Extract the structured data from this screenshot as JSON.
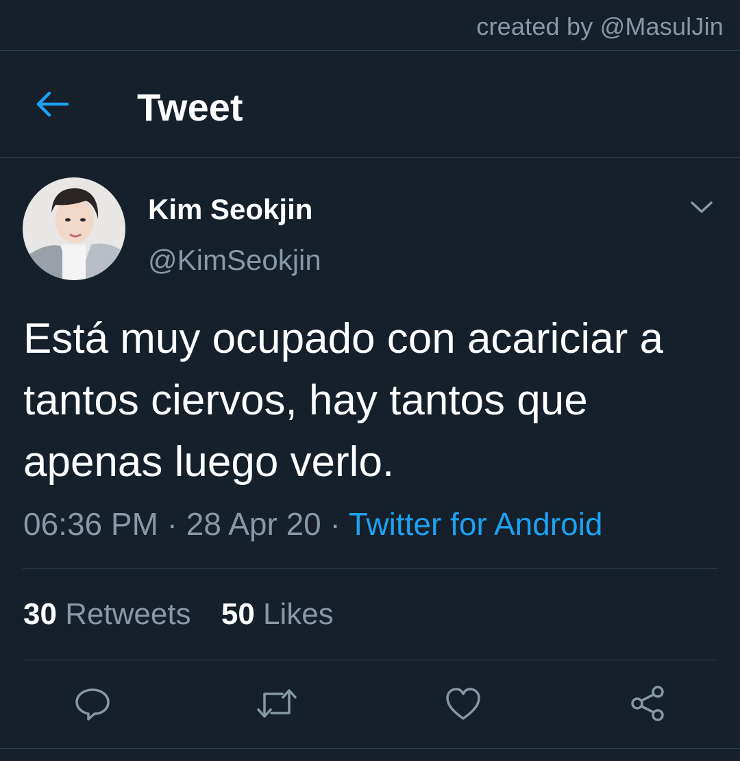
{
  "watermark": "created by @MasulJin",
  "header": {
    "title": "Tweet",
    "back_icon": "back-arrow-icon"
  },
  "author": {
    "name": "Kim Seokjin",
    "handle": "@KimSeokjin"
  },
  "tweet": {
    "text": "Está muy ocupado con acariciar a tantos ciervos, hay tantos que apenas luego verlo.",
    "time": "06:36 PM",
    "separator": " · ",
    "date": "28 Apr 20",
    "source": "Twitter for Android"
  },
  "stats": {
    "retweets_count": "30",
    "retweets_label": "Retweets",
    "likes_count": "50",
    "likes_label": "Likes"
  },
  "actions": [
    "reply-icon",
    "retweet-icon",
    "like-icon",
    "share-icon"
  ],
  "colors": {
    "background": "#15202b",
    "accent": "#1da1f2",
    "secondary_text": "#8899a6",
    "border": "#38444d",
    "primary_text": "#ffffff"
  }
}
